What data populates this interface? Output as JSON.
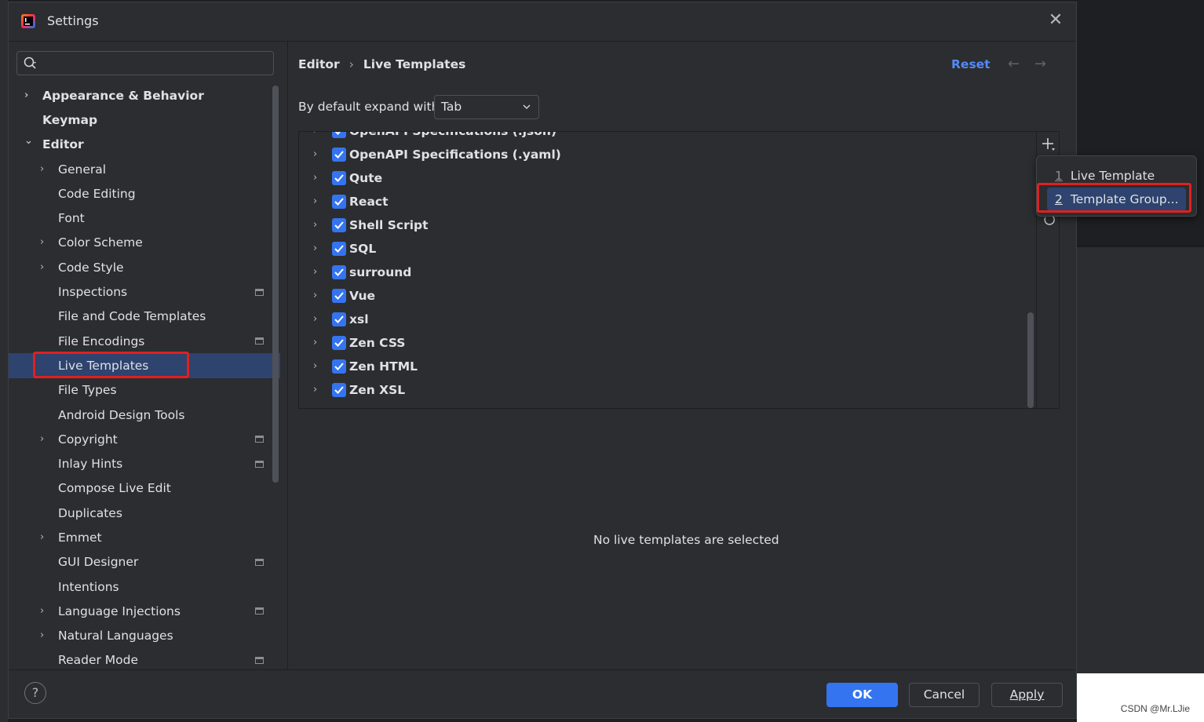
{
  "dialog": {
    "title": "Settings"
  },
  "search": {
    "placeholder": ""
  },
  "sidebar": {
    "items": [
      {
        "label": "Appearance & Behavior",
        "bold": true,
        "level": 0,
        "expandable": true,
        "expanded": false,
        "project_icon": false
      },
      {
        "label": "Keymap",
        "bold": true,
        "level": 0,
        "expandable": false,
        "project_icon": false
      },
      {
        "label": "Editor",
        "bold": true,
        "level": 0,
        "expandable": true,
        "expanded": true,
        "project_icon": false
      },
      {
        "label": "General",
        "level": 1,
        "expandable": true,
        "project_icon": false
      },
      {
        "label": "Code Editing",
        "level": 1,
        "expandable": false,
        "project_icon": false
      },
      {
        "label": "Font",
        "level": 1,
        "expandable": false,
        "project_icon": false
      },
      {
        "label": "Color Scheme",
        "level": 1,
        "expandable": true,
        "project_icon": false
      },
      {
        "label": "Code Style",
        "level": 1,
        "expandable": true,
        "project_icon": false
      },
      {
        "label": "Inspections",
        "level": 1,
        "expandable": false,
        "project_icon": true
      },
      {
        "label": "File and Code Templates",
        "level": 1,
        "expandable": false,
        "project_icon": false
      },
      {
        "label": "File Encodings",
        "level": 1,
        "expandable": false,
        "project_icon": true
      },
      {
        "label": "Live Templates",
        "level": 1,
        "expandable": false,
        "project_icon": false,
        "selected": true
      },
      {
        "label": "File Types",
        "level": 1,
        "expandable": false,
        "project_icon": false
      },
      {
        "label": "Android Design Tools",
        "level": 1,
        "expandable": false,
        "project_icon": false
      },
      {
        "label": "Copyright",
        "level": 1,
        "expandable": true,
        "project_icon": true
      },
      {
        "label": "Inlay Hints",
        "level": 1,
        "expandable": false,
        "project_icon": true
      },
      {
        "label": "Compose Live Edit",
        "level": 1,
        "expandable": false,
        "project_icon": false
      },
      {
        "label": "Duplicates",
        "level": 1,
        "expandable": false,
        "project_icon": false
      },
      {
        "label": "Emmet",
        "level": 1,
        "expandable": true,
        "project_icon": false
      },
      {
        "label": "GUI Designer",
        "level": 1,
        "expandable": false,
        "project_icon": true
      },
      {
        "label": "Intentions",
        "level": 1,
        "expandable": false,
        "project_icon": false
      },
      {
        "label": "Language Injections",
        "level": 1,
        "expandable": true,
        "project_icon": true
      },
      {
        "label": "Natural Languages",
        "level": 1,
        "expandable": true,
        "project_icon": false
      },
      {
        "label": "Reader Mode",
        "level": 1,
        "expandable": false,
        "project_icon": true
      }
    ]
  },
  "breadcrumb": {
    "parent": "Editor",
    "separator": "›",
    "current": "Live Templates"
  },
  "header": {
    "reset_label": "Reset",
    "back_icon": "←",
    "forward_icon": "→"
  },
  "expand": {
    "label": "By default expand with",
    "value": "Tab"
  },
  "template_groups": [
    {
      "label": "OpenAPI Specifications (.json)",
      "checked": true
    },
    {
      "label": "OpenAPI Specifications (.yaml)",
      "checked": true
    },
    {
      "label": "Qute",
      "checked": true
    },
    {
      "label": "React",
      "checked": true
    },
    {
      "label": "Shell Script",
      "checked": true
    },
    {
      "label": "SQL",
      "checked": true
    },
    {
      "label": "surround",
      "checked": true
    },
    {
      "label": "Vue",
      "checked": true
    },
    {
      "label": "xsl",
      "checked": true
    },
    {
      "label": "Zen CSS",
      "checked": true
    },
    {
      "label": "Zen HTML",
      "checked": true
    },
    {
      "label": "Zen XSL",
      "checked": true
    }
  ],
  "empty_message": "No live templates are selected",
  "popup": {
    "items": [
      {
        "mnemonic": "1",
        "label": "Live Template",
        "active": false
      },
      {
        "mnemonic": "2",
        "label": "Template Group...",
        "active": true
      }
    ]
  },
  "footer": {
    "ok_label": "OK",
    "cancel_label": "Cancel",
    "apply_label": "Apply",
    "help_label": "?"
  },
  "watermark": "CSDN @Mr.LJie",
  "colors": {
    "accent": "#3574f0",
    "selection": "#2e436e",
    "link": "#548af7",
    "highlight": "#e02020",
    "background": "#2b2d30"
  }
}
